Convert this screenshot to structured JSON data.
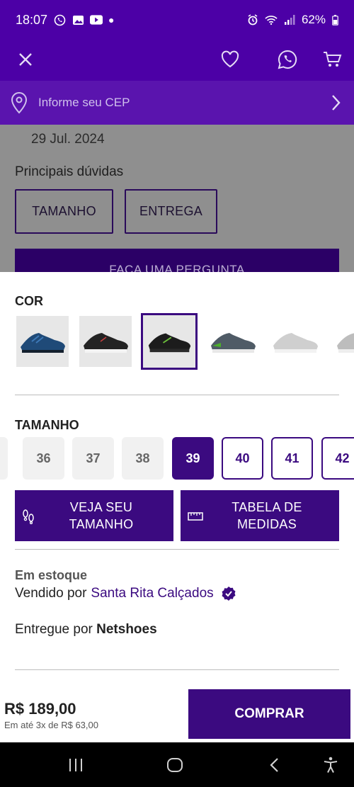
{
  "status_bar": {
    "time": "18:07",
    "battery": "62%"
  },
  "header": {
    "close_icon": "close-icon",
    "favorite_icon": "heart-icon",
    "whatsapp_icon": "whatsapp-icon",
    "cart_icon": "cart-icon"
  },
  "cep": {
    "placeholder": "Informe seu CEP"
  },
  "background": {
    "date": "29 Jul. 2024",
    "questions_title": "Principais dúvidas",
    "chips": [
      "TAMANHO",
      "ENTREGA"
    ],
    "ask_button": "FAÇA UMA PERGUNTA"
  },
  "colors_section": {
    "title": "COR",
    "selected_index": 2
  },
  "sizes_section": {
    "title": "TAMANHO",
    "sizes": [
      {
        "label": "36",
        "state": "unavailable"
      },
      {
        "label": "37",
        "state": "unavailable"
      },
      {
        "label": "38",
        "state": "unavailable"
      },
      {
        "label": "39",
        "state": "selected"
      },
      {
        "label": "40",
        "state": "available"
      },
      {
        "label": "41",
        "state": "available"
      },
      {
        "label": "42",
        "state": "available"
      }
    ],
    "find_size_button": "VEJA SEU TAMANHO",
    "size_chart_button": "TABELA DE MEDIDAS"
  },
  "availability": {
    "stock": "Em estoque",
    "sold_by_prefix": "Vendido por",
    "seller": "Santa Rita Calçados",
    "delivered_by_prefix": "Entregue por",
    "delivered_by": "Netshoes"
  },
  "buy": {
    "price": "R$ 189,00",
    "installments": "Em até 3x de R$ 63,00",
    "button": "COMPRAR"
  },
  "colors": {
    "brand": "#4c00a6",
    "primary": "#3b0a80"
  }
}
